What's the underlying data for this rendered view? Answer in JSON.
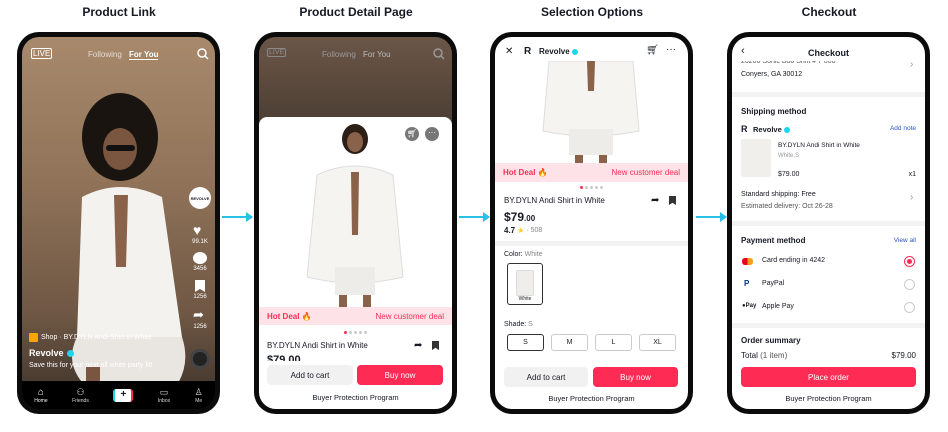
{
  "titles": {
    "p1": "Product Link",
    "p2": "Product Detail Page",
    "p3": "Selection Options",
    "p4": "Checkout"
  },
  "colors": {
    "accent": "#fe2c55",
    "arrow": "#27c1e8",
    "verified": "#20d5ec"
  },
  "feed": {
    "tab_following": "Following",
    "tab_foryou": "For You",
    "live_icon": "live-icon",
    "likes": "99.1K",
    "comments": "3456",
    "saves": "1256",
    "shares": "1256",
    "brand_badge": "REVOLVE",
    "shop_label": "Shop · BY.DYLN Andi Shirt in White",
    "username": "Revolve",
    "caption": "Save this for your next all white party fit!",
    "nav": [
      "Home",
      "Friends",
      "",
      "Inbox",
      "Me"
    ]
  },
  "pdp": {
    "tab_following": "Following",
    "tab_foryou": "For You",
    "hot_deal": "Hot Deal 🔥",
    "new_customer": "New customer deal",
    "product_name": "BY.DYLN Andi Shirt in White",
    "price_partial": "$79.00",
    "add_to_cart": "Add to cart",
    "buy_now": "Buy now",
    "buyer_protection": "Buyer Protection Program"
  },
  "select": {
    "brand": "Revolve",
    "hot_deal": "Hot Deal 🔥",
    "new_customer": "New customer deal",
    "product_name": "BY.DYLN Andi Shirt in White",
    "price_dollars": "$79",
    "price_cents": ".00",
    "rating": "4.7",
    "star": "★",
    "reviews": "· 508",
    "color_label": "Color:",
    "color_value": "White",
    "swatch_label": "White",
    "shade_label": "Shade:",
    "shade_value": "S",
    "sizes": [
      "S",
      "M",
      "L",
      "XL"
    ],
    "add_to_cart": "Add to cart",
    "buy_now": "Buy now",
    "buyer_protection": "Buyer Protection Program"
  },
  "checkout": {
    "title": "Checkout",
    "address_line1": "20200 Sonic Boo Shift # 7 000",
    "address_line2": "Conyers, GA 30012",
    "shipping_header": "Shipping method",
    "store": "Revolve",
    "add_note": "Add note",
    "item_name": "BY.DYLN Andi Shirt in White",
    "item_variant": "White,S",
    "item_price": "$79.00",
    "item_qty": "x1",
    "ship_standard": "Standard shipping: Free",
    "ship_delivery": "Estimated delivery: Oct 26-28",
    "payment_header": "Payment method",
    "view_all": "View all",
    "payments": [
      "Card ending in 4242",
      "PayPal",
      "Apple Pay"
    ],
    "payment_selected_index": 0,
    "summary_header": "Order summary",
    "total_label": "Total",
    "total_items": "(1 item)",
    "total_value": "$79.00",
    "place_order": "Place order",
    "buyer_protection": "Buyer Protection Program"
  }
}
